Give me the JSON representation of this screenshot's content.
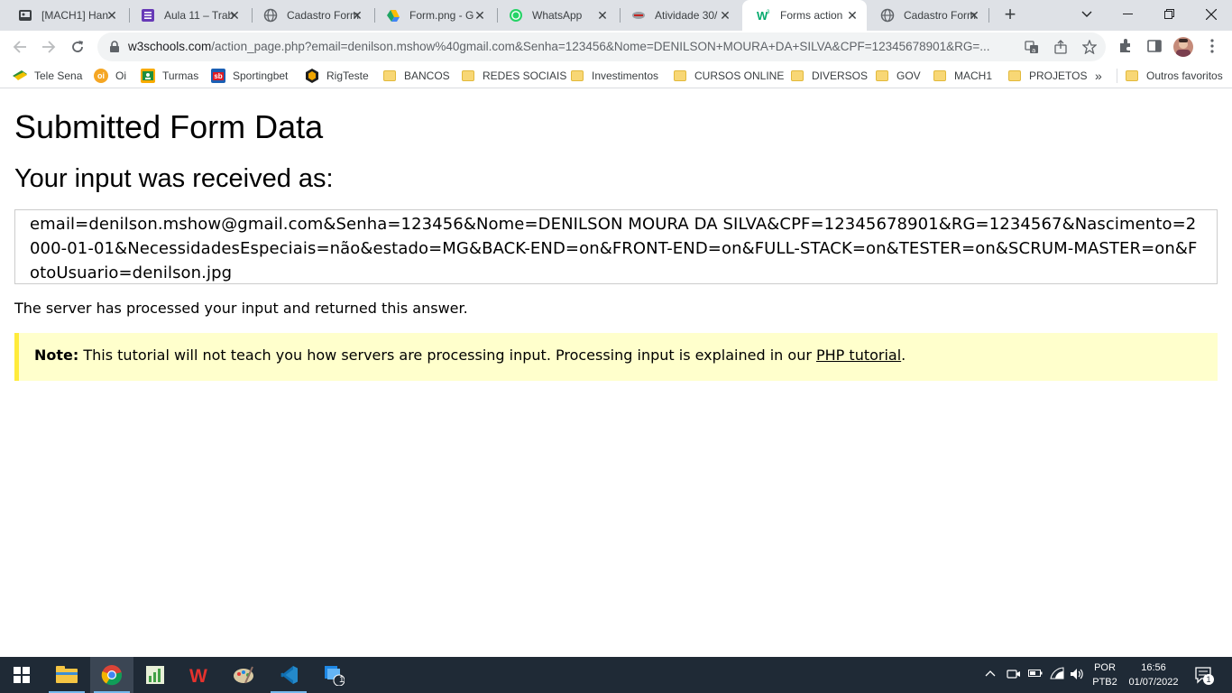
{
  "browser": {
    "tabs": [
      {
        "title": "[MACH1] Han",
        "icon": "page-icon"
      },
      {
        "title": "Aula 11 – Trab",
        "icon": "forms-icon"
      },
      {
        "title": "Cadastro Form",
        "icon": "globe-icon"
      },
      {
        "title": "Form.png - G",
        "icon": "drive-icon"
      },
      {
        "title": "WhatsApp",
        "icon": "whatsapp-icon"
      },
      {
        "title": "Atividade 30/",
        "icon": "app-icon"
      },
      {
        "title": "Forms action",
        "icon": "w3schools-icon",
        "active": true
      },
      {
        "title": "Cadastro Form",
        "icon": "globe-icon"
      }
    ],
    "url_domain": "w3schools.com",
    "url_path": "/action_page.php?email=denilson.mshow%40gmail.com&Senha=123456&Nome=DENILSON+MOURA+DA+SILVA&CPF=12345678901&RG=...",
    "bookmarks": [
      {
        "label": "Tele Sena",
        "icon": "telesena-icon"
      },
      {
        "label": "Oi",
        "icon": "oi-icon"
      },
      {
        "label": "Turmas",
        "icon": "classroom-icon"
      },
      {
        "label": "Sportingbet",
        "icon": "sportingbet-icon"
      },
      {
        "label": "RigTeste",
        "icon": "rigteste-icon"
      },
      {
        "label": "BANCOS",
        "icon": "folder-icon"
      },
      {
        "label": "REDES SOCIAIS",
        "icon": "folder-icon"
      },
      {
        "label": "Investimentos",
        "icon": "folder-icon"
      },
      {
        "label": "CURSOS ONLINE",
        "icon": "folder-icon"
      },
      {
        "label": "DIVERSOS",
        "icon": "folder-icon"
      },
      {
        "label": "GOV",
        "icon": "folder-icon"
      },
      {
        "label": "MACH1",
        "icon": "folder-icon"
      },
      {
        "label": "PROJETOS",
        "icon": "folder-icon"
      }
    ],
    "more_bookmarks": "»",
    "other_bookmarks": "Outros favoritos"
  },
  "page": {
    "title": "Submitted Form Data",
    "subtitle": "Your input was received as:",
    "result": "email=denilson.mshow@gmail.com&Senha=123456&Nome=DENILSON MOURA DA SILVA&CPF=12345678901&RG=1234567&Nascimento=2000-01-01&NecessidadesEspeciais=não&estado=MG&BACK-END=on&FRONT-END=on&FULL-STACK=on&TESTER=on&SCRUM-MASTER=on&FotoUsuario=denilson.jpg",
    "server_text": "The server has processed your input and returned this answer.",
    "note_label": "Note:",
    "note_text": " This tutorial will not teach you how servers are processing input. Processing input is explained in our ",
    "note_link": "PHP tutorial",
    "note_end": "."
  },
  "taskbar": {
    "lang_top": "POR",
    "lang_bottom": "PTB2",
    "time": "16:56",
    "date": "01/07/2022",
    "notification_count": "1",
    "vs_badge": "1"
  },
  "colors": {
    "note_bg": "#ffffcc",
    "note_border": "#ffeb3b",
    "taskbar": "#1f2a36"
  }
}
